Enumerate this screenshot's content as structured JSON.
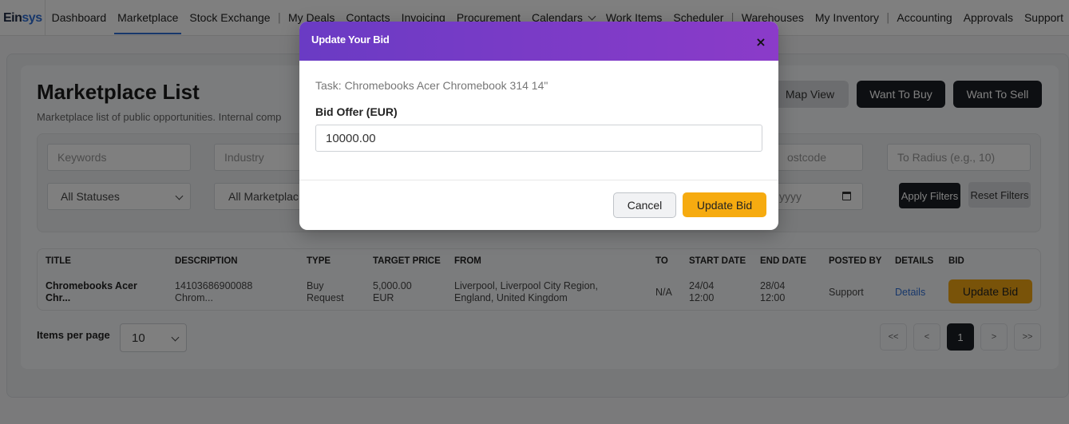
{
  "nav": {
    "logo_part1": "Ein",
    "logo_part2": "sys",
    "items": [
      "Dashboard",
      "Marketplace",
      "Stock Exchange",
      "My Deals",
      "Contacts",
      "Invoicing",
      "Procurement",
      "Calendars",
      "Work Items",
      "Scheduler",
      "Warehouses",
      "My Inventory",
      "Accounting",
      "Approvals",
      "Support"
    ],
    "separator": "|"
  },
  "page": {
    "title": "Marketplace List",
    "subtitle": "Marketplace list of public opportunities. Internal comp",
    "buttons": {
      "map_view": "Map View",
      "want_to_buy": "Want To Buy",
      "want_to_sell": "Want To Sell"
    }
  },
  "filters": {
    "keywords_placeholder": "Keywords",
    "industry_placeholder": "Industry",
    "postcode_placeholder": "ostcode",
    "radius_placeholder": "To Radius (e.g., 10)",
    "status_selected": "All Statuses",
    "marketplace_selected": "All Marketplac",
    "date_placeholder": "yyyy",
    "apply": "Apply Filters",
    "reset": "Reset Filters"
  },
  "table": {
    "headers": [
      "TITLE",
      "DESCRIPTION",
      "TYPE",
      "TARGET PRICE",
      "FROM",
      "TO",
      "START DATE",
      "END DATE",
      "POSTED BY",
      "DETAILS",
      "BID"
    ],
    "row": {
      "title_l1": "Chromebooks Acer",
      "title_l2": "Chr...",
      "desc_l1": "14103686900088",
      "desc_l2": "Chrom...",
      "type_l1": "Buy",
      "type_l2": "Request",
      "price_l1": "5,000.00",
      "price_l2": "EUR",
      "from_l1": "Liverpool, Liverpool City Region,",
      "from_l2": "England, United Kingdom",
      "to": "N/A",
      "start_l1": "24/04",
      "start_l2": "12:00",
      "end_l1": "28/04",
      "end_l2": "12:00",
      "posted_by": "Support",
      "details": "Details",
      "bid": "Update Bid"
    }
  },
  "pagination": {
    "items_per_page_label": "Items per page",
    "items_per_page_value": "10",
    "first": "<<",
    "prev": "<",
    "current": "1",
    "next": ">",
    "last": ">>"
  },
  "modal": {
    "title": "Update Your Bid",
    "close": "×",
    "task": "Task: Chromebooks Acer Chromebook 314 14\"",
    "bid_label": "Bid Offer (EUR)",
    "bid_value": "10000.00",
    "cancel": "Cancel",
    "update": "Update Bid"
  },
  "colors": {
    "accent_purple": "#7a3bc7",
    "update_yellow": "#f6ab10",
    "dark_button": "#1b1f24",
    "link_blue": "#2f6fd6"
  }
}
